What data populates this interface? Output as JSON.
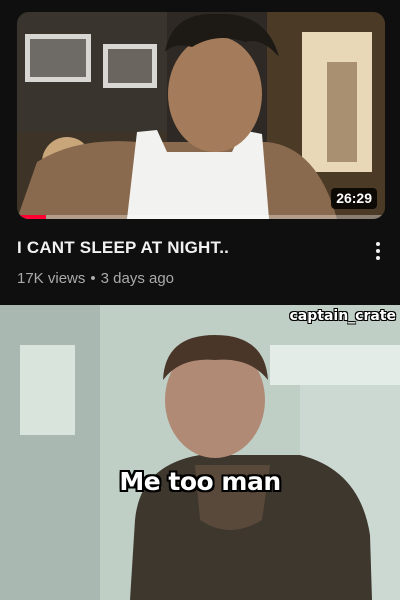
{
  "video": {
    "duration": "26:29",
    "title": "I CANT SLEEP AT NIGHT..",
    "views": "17K views",
    "separator": "•",
    "age": "3 days ago",
    "watch_progress": 0.08,
    "more_icon": "more-vertical-icon"
  },
  "meme": {
    "watermark": "captain_crate",
    "caption": "Me too man"
  },
  "colors": {
    "background": "#0f0f0f",
    "progress": "#ff0033",
    "meta_text": "#aaaaaa"
  }
}
